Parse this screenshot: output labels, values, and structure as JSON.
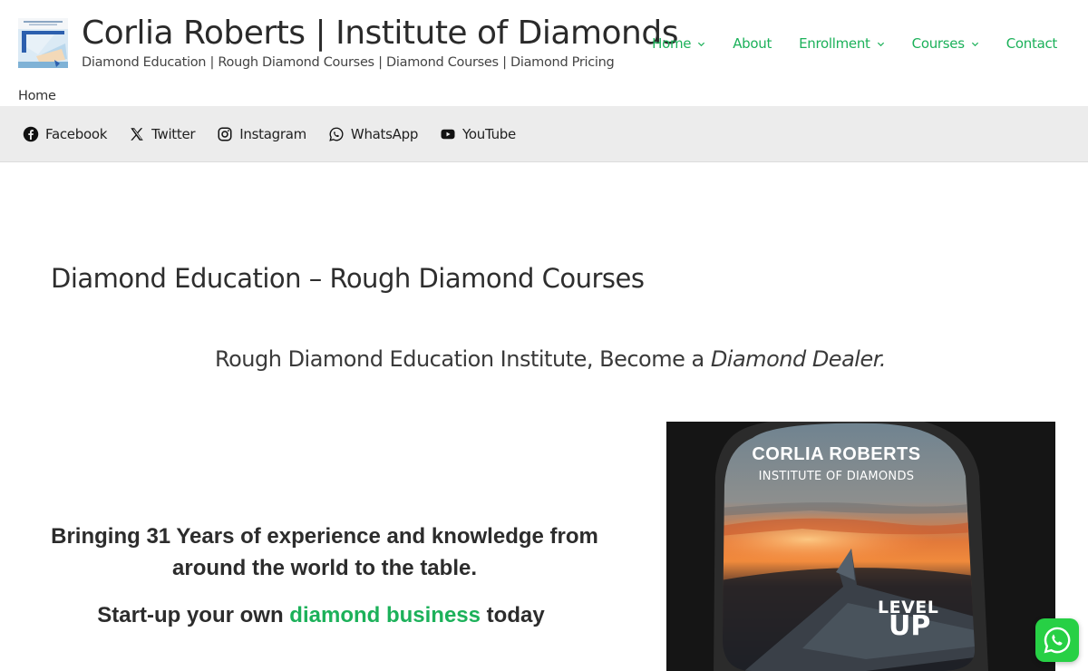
{
  "header": {
    "logo_alt": "Corlia Roberts Institute of Diamonds logo",
    "title": "Corlia Roberts | Institute of Diamonds",
    "tagline": "Diamond Education | Rough Diamond Courses | Diamond Courses | Diamond Pricing"
  },
  "nav": {
    "items": [
      {
        "label": "Home",
        "has_dropdown": true
      },
      {
        "label": "About",
        "has_dropdown": false
      },
      {
        "label": "Enrollment",
        "has_dropdown": true
      },
      {
        "label": "Courses",
        "has_dropdown": true
      },
      {
        "label": "Contact",
        "has_dropdown": false
      }
    ],
    "color": "#1cb15a"
  },
  "breadcrumb": "Home",
  "social": [
    {
      "label": "Facebook",
      "icon": "facebook-icon"
    },
    {
      "label": "Twitter",
      "icon": "x-twitter-icon"
    },
    {
      "label": "Instagram",
      "icon": "instagram-icon"
    },
    {
      "label": "WhatsApp",
      "icon": "whatsapp-icon"
    },
    {
      "label": "YouTube",
      "icon": "youtube-icon"
    }
  ],
  "content": {
    "heading": "Diamond Education – Rough Diamond Courses",
    "subheading_plain": "Rough Diamond Education Institute, Become a ",
    "subheading_italic": "Diamond Dealer.",
    "experience": "Bringing 31 Years of experience and knowledge from around the world to the table.",
    "startup_before": "Start-up your own ",
    "startup_highlight": "diamond business",
    "startup_after": " today"
  },
  "promo": {
    "name": "CORLIA ROBERTS",
    "subtitle": "INSTITUTE OF DIAMONDS",
    "level": "LEVEL",
    "up": "UP"
  },
  "colors": {
    "accent": "#1cb15a",
    "social_bar_bg": "#ececec",
    "whatsapp": "#27d045"
  }
}
